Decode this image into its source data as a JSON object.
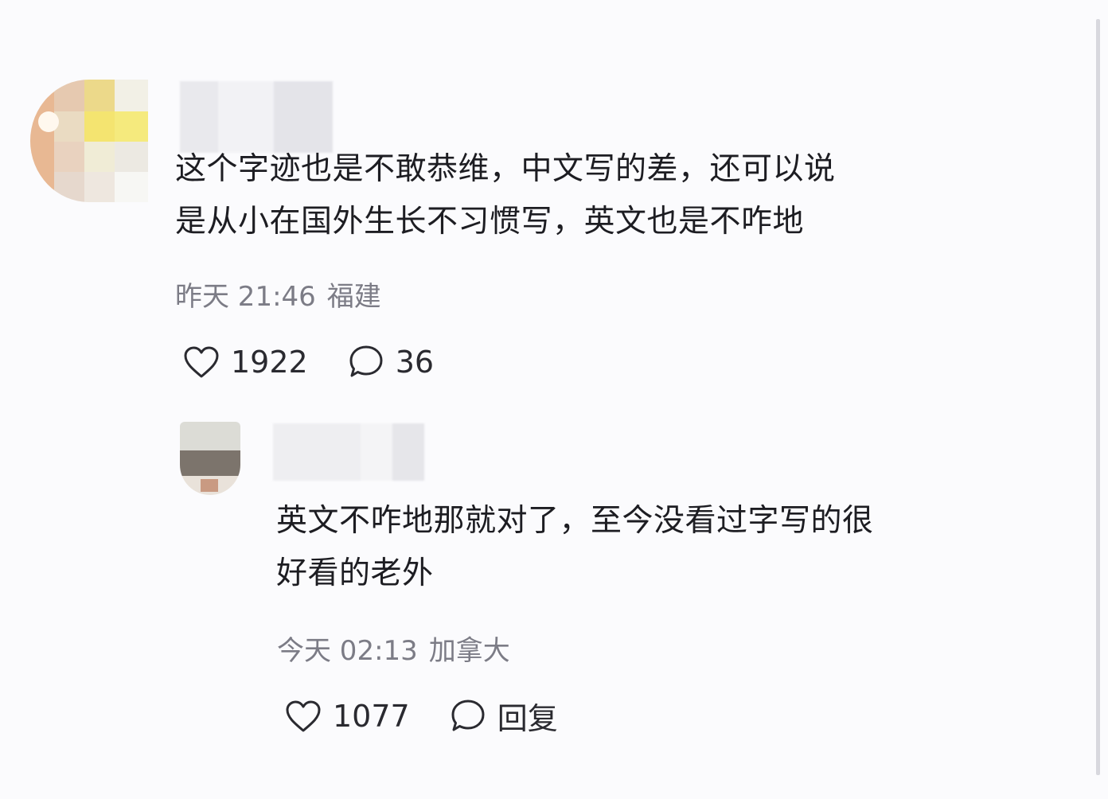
{
  "comments": [
    {
      "text": "这个字迹也是不敢恭维，中文写的差，还可以说\n是从小在国外生长不习惯写，英文也是不咋地",
      "time": "昨天 21:46",
      "location": "福建",
      "likes": "1922",
      "reply_count": "36",
      "icons": {
        "like": "heart-icon",
        "comment": "comment-bubble-icon"
      }
    },
    {
      "text": "英文不咋地那就对了，至今没看过字写的很\n好看的老外",
      "time": "今天 02:13",
      "location": "加拿大",
      "likes": "1077",
      "reply_label": "回复",
      "icons": {
        "like": "heart-icon",
        "comment": "comment-bubble-icon"
      }
    }
  ],
  "colors": {
    "background": "#fbfbfd",
    "text": "#1d1d22",
    "meta": "#7c7c86"
  }
}
